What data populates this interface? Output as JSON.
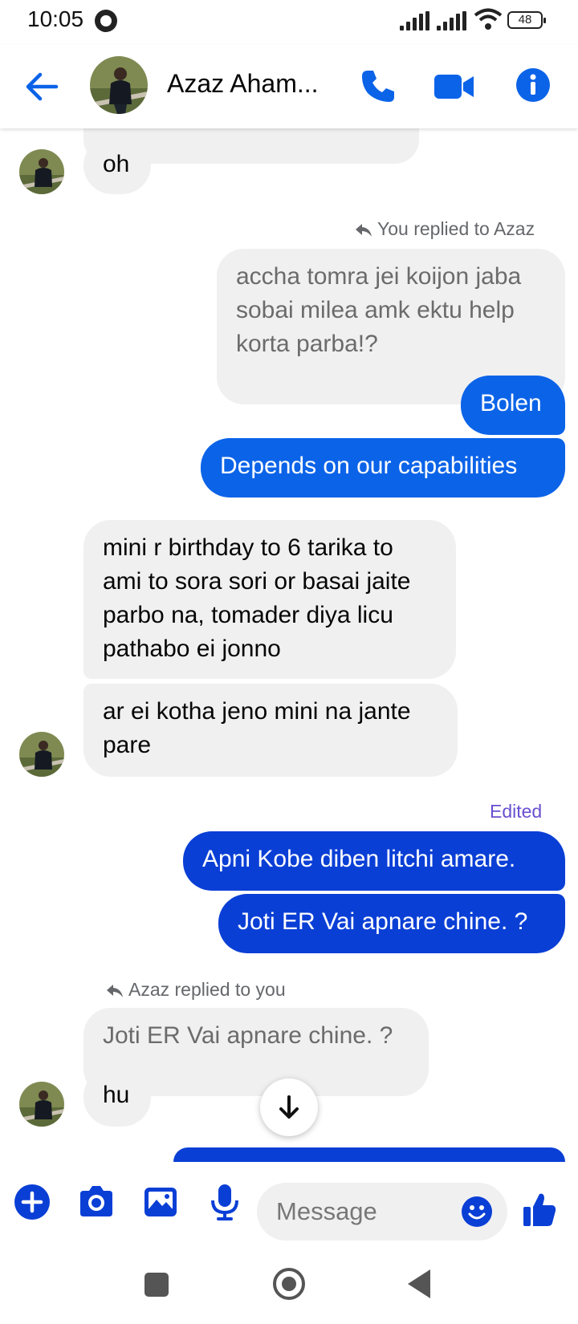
{
  "status_bar": {
    "time": "10:05",
    "battery": "48"
  },
  "header": {
    "contact_name": "Azaz Aham..."
  },
  "messages": {
    "m1": "oh",
    "reply_label_1": "You replied to Azaz",
    "quote_1": "accha tomra jei koijon jaba sobai milea amk ektu help korta parba!?",
    "m2": "Bolen",
    "m3": "Depends on our capabilities",
    "m4": "mini r birthday to 6 tarika to ami to sora sori or basai jaite parbo na, tomader diya licu pathabo ei jonno",
    "m5": "ar ei kotha jeno mini na jante pare",
    "edited_label": "Edited",
    "m6": "Apni Kobe diben litchi amare.",
    "m7": "Joti ER Vai apnare chine. ?",
    "reply_label_2": "Azaz replied to you",
    "quote_2": "Joti ER Vai apnare chine. ?",
    "m8": "hu"
  },
  "composer": {
    "placeholder": "Message"
  },
  "colors": {
    "accent": "#0b63e8",
    "sent_bubble": "#0a3fd6",
    "received_bubble": "#f0f0f0",
    "edited": "#6a4fd1"
  }
}
